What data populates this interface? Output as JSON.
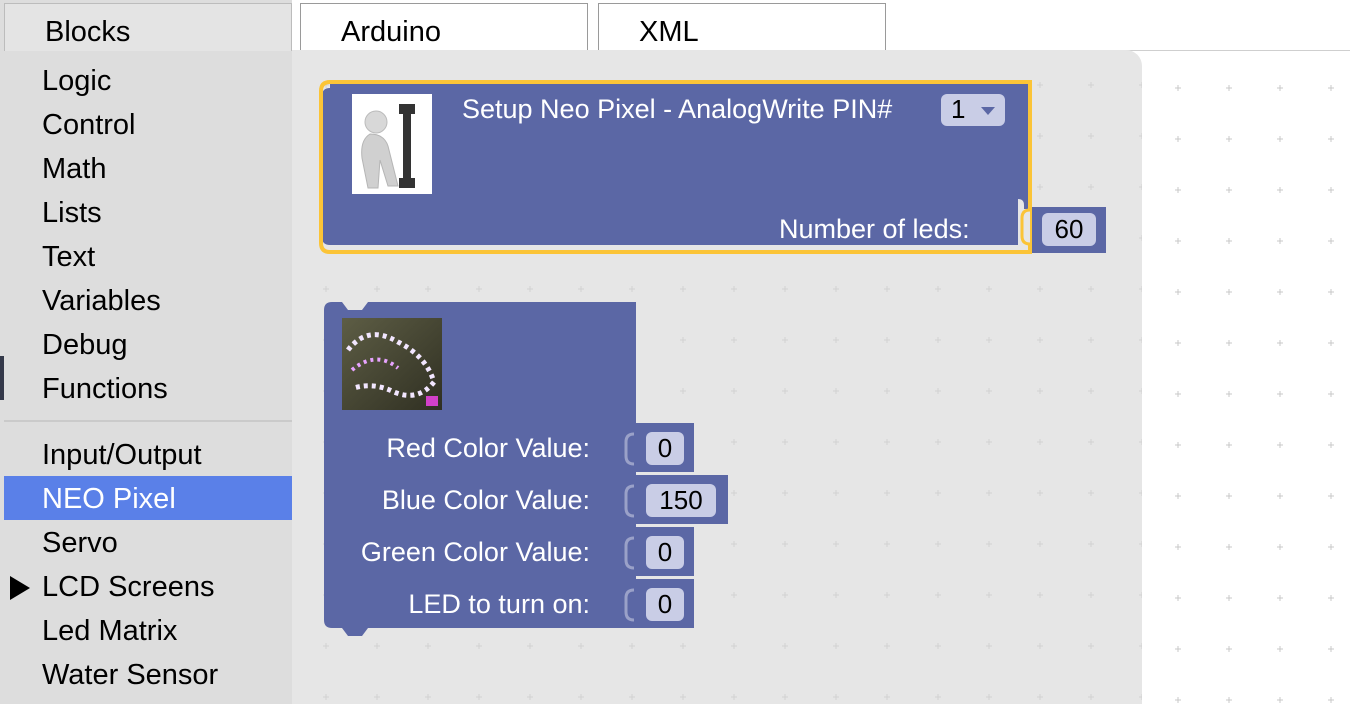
{
  "tabs": [
    {
      "label": "Blocks"
    },
    {
      "label": "Arduino"
    },
    {
      "label": "XML"
    }
  ],
  "toolbox": {
    "categories": [
      {
        "label": "Logic"
      },
      {
        "label": "Control"
      },
      {
        "label": "Math"
      },
      {
        "label": "Lists"
      },
      {
        "label": "Text"
      },
      {
        "label": "Variables"
      },
      {
        "label": "Debug"
      },
      {
        "label": "Functions"
      },
      {
        "label": "Input/Output"
      },
      {
        "label": "NEO Pixel",
        "selected": true
      },
      {
        "label": "Servo"
      },
      {
        "label": "LCD Screens",
        "expandable": true
      },
      {
        "label": "Led Matrix"
      },
      {
        "label": "Water Sensor"
      }
    ]
  },
  "setup_block": {
    "title": "Setup Neo Pixel - AnalogWrite PIN#",
    "pin_value": "1",
    "leds_label": "Number of leds:",
    "leds_value": "60",
    "icon": "person-wrench-icon"
  },
  "color_block": {
    "icon": "led-strip-photo",
    "red_label": "Red Color Value:",
    "red_value": "0",
    "blue_label": "Blue Color Value:",
    "blue_value": "150",
    "green_label": "Green Color Value:",
    "green_value": "0",
    "led_label": "LED to turn on:",
    "led_value": "0"
  },
  "colors": {
    "block": "#5b67a5",
    "selected_outline": "#fbc437",
    "selected_category": "#5a80e8",
    "workspace": "#e6e6e6"
  }
}
